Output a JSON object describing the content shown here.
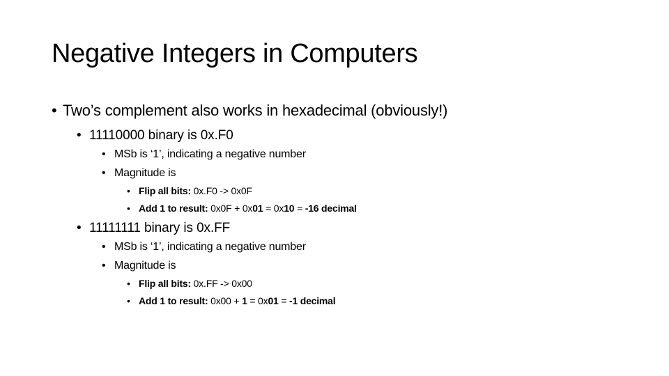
{
  "slide": {
    "title": "Negative Integers in Computers",
    "bullet_glyph": "•",
    "items": [
      {
        "level": 1,
        "text": "Two’s complement also works in hexadecimal (obviously!)"
      },
      {
        "level": 2,
        "text": "11110000 binary is 0x.F0"
      },
      {
        "level": 3,
        "text": "MSb is ‘1’, indicating a negative number"
      },
      {
        "level": 3,
        "text": "Magnitude is"
      },
      {
        "level": 4,
        "runs": [
          {
            "text": "Flip all bits: ",
            "bold": true
          },
          {
            "text": "0x.F0 -> 0x0F",
            "bold": false
          }
        ]
      },
      {
        "level": 4,
        "runs": [
          {
            "text": "Add 1 to result: ",
            "bold": true
          },
          {
            "text": "0x0F + 0x",
            "bold": false
          },
          {
            "text": "01",
            "bold": true
          },
          {
            "text": " = 0x",
            "bold": false
          },
          {
            "text": "10",
            "bold": true
          },
          {
            "text": " = ",
            "bold": false
          },
          {
            "text": "-16 decimal",
            "bold": true
          }
        ]
      },
      {
        "level": 2,
        "text": "11111111 binary is 0x.FF"
      },
      {
        "level": 3,
        "text": "MSb is ‘1’, indicating a negative number"
      },
      {
        "level": 3,
        "text": "Magnitude is"
      },
      {
        "level": 4,
        "runs": [
          {
            "text": "Flip all bits: ",
            "bold": true
          },
          {
            "text": "0x.FF -> 0x00",
            "bold": false
          }
        ]
      },
      {
        "level": 4,
        "runs": [
          {
            "text": "Add 1 to result: ",
            "bold": true
          },
          {
            "text": "0x00 + ",
            "bold": false
          },
          {
            "text": "1",
            "bold": true
          },
          {
            "text": " = 0x",
            "bold": false
          },
          {
            "text": "01",
            "bold": true
          },
          {
            "text": " = ",
            "bold": false
          },
          {
            "text": "-1 decimal",
            "bold": true
          }
        ]
      }
    ]
  }
}
